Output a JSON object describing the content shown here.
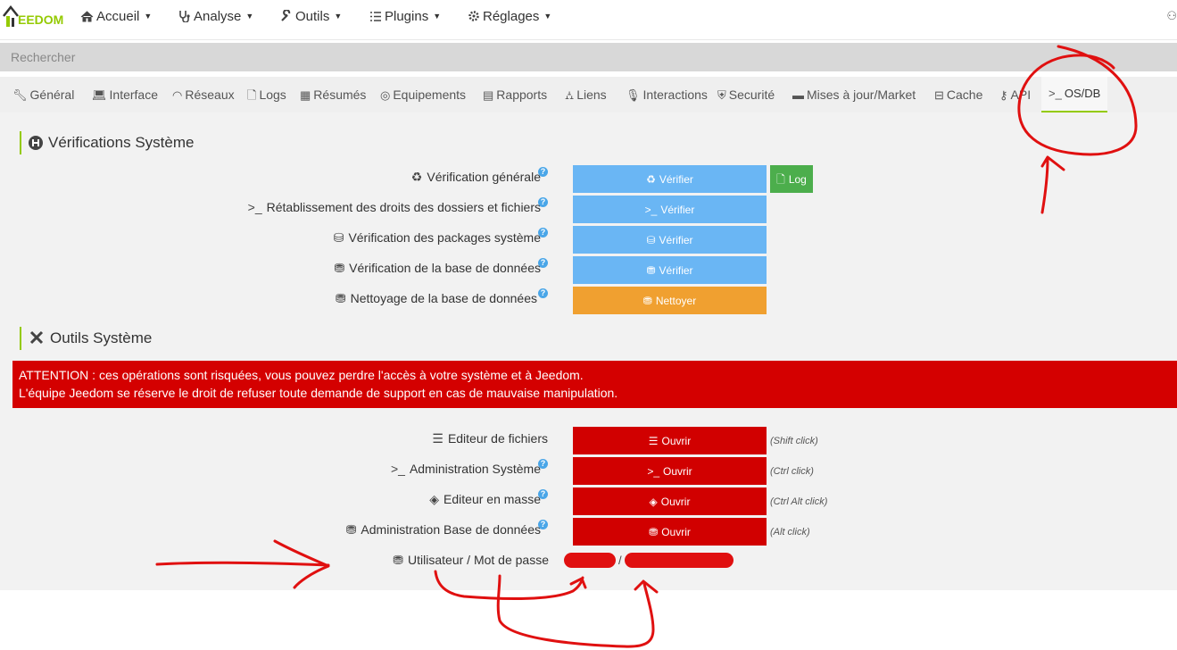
{
  "nav": {
    "logo_text": "EEDOM",
    "items": [
      {
        "label": "Accueil",
        "icon": "home-icon"
      },
      {
        "label": "Analyse",
        "icon": "stethoscope-icon"
      },
      {
        "label": "Outils",
        "icon": "wrench-icon"
      },
      {
        "label": "Plugins",
        "icon": "tasks-icon"
      },
      {
        "label": "Réglages",
        "icon": "cogs-icon"
      }
    ]
  },
  "search": {
    "placeholder": "Rechercher",
    "value": ""
  },
  "tabs": [
    {
      "label": "Général",
      "icon": "wrench-icon"
    },
    {
      "label": "Interface",
      "icon": "laptop-icon"
    },
    {
      "label": "Réseaux",
      "icon": "rss-icon"
    },
    {
      "label": "Logs",
      "icon": "file-icon"
    },
    {
      "label": "Résumés",
      "icon": "table-icon"
    },
    {
      "label": "Equipements",
      "icon": "circle-icon"
    },
    {
      "label": "Rapports",
      "icon": "newspaper-icon"
    },
    {
      "label": "Liens",
      "icon": "sitemap-icon"
    },
    {
      "label": "Interactions",
      "icon": "microphone-icon"
    },
    {
      "label": "Securité",
      "icon": "shield-icon"
    },
    {
      "label": "Mises à jour/Market",
      "icon": "server-icon"
    },
    {
      "label": "Cache",
      "icon": "hdd-icon"
    },
    {
      "label": "API",
      "icon": "key-icon"
    },
    {
      "label": "OS/DB",
      "icon": "terminal-icon",
      "active": true
    }
  ],
  "verif": {
    "title": "Vérifications Système",
    "rows": [
      {
        "label": "Vérification générale",
        "button": "Vérifier",
        "extra_button": "Log"
      },
      {
        "label": "Rétablissement des droits des dossiers et fichiers",
        "button": "Vérifier"
      },
      {
        "label": "Vérification des packages système",
        "button": "Vérifier"
      },
      {
        "label": "Vérification de la base de données",
        "button": "Vérifier"
      },
      {
        "label": "Nettoyage de la base de données",
        "button": "Nettoyer"
      }
    ]
  },
  "tools": {
    "title": "Outils Système",
    "alert_line1": "ATTENTION : ces opérations sont risquées, vous pouvez perdre l'accès à votre système et à Jeedom.",
    "alert_line2": "L'équipe Jeedom se réserve le droit de refuser toute demande de support en cas de mauvaise manipulation.",
    "rows": [
      {
        "label": "Editeur de fichiers",
        "button": "Ouvrir",
        "hint": "(Shift click)"
      },
      {
        "label": "Administration Système",
        "button": "Ouvrir",
        "hint": "(Ctrl click)"
      },
      {
        "label": "Editeur en masse",
        "button": "Ouvrir",
        "hint": "(Ctrl Alt click)"
      },
      {
        "label": "Administration Base de données",
        "button": "Ouvrir",
        "hint": "(Alt click)"
      }
    ],
    "credentials_label": "Utilisateur / Mot de passe",
    "credentials_separator": "/"
  },
  "colors": {
    "accent": "#94ca02",
    "blue_button": "#6ab6f4",
    "orange_button": "#f0a030",
    "red_button": "#d10000",
    "green_button": "#4cae4c",
    "annotation": "#e01010"
  }
}
